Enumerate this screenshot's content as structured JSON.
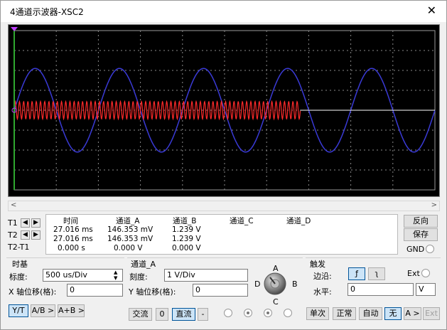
{
  "window": {
    "title": "4通道示波器-XSC2",
    "close_glyph": "✕"
  },
  "scope": {
    "background": "#000000",
    "grid_color": "#8a8a8a",
    "channel_a_color": "#ff2a2a",
    "channel_b_color": "#3a3ad6",
    "channel_a_label": "A",
    "channel_b_label": "B",
    "trace_a": {
      "waveform": "sine",
      "cycles_shown": 100,
      "amplitude_divisions": 0.2,
      "visible_until_fraction": 0.68
    },
    "trace_b": {
      "waveform": "sine",
      "cycles_shown": 5,
      "amplitude_divisions": 2.1
    }
  },
  "cursors": {
    "t1": "T1",
    "t2": "T2",
    "t2t1": "T2-T1"
  },
  "measure": {
    "headers": [
      "时间",
      "通道_A",
      "通道_B",
      "通道_C",
      "通道_D"
    ],
    "rows": [
      [
        "27.016 ms",
        "146.353 mV",
        "1.239 V",
        "",
        ""
      ],
      [
        "27.016 ms",
        "146.353 mV",
        "1.239 V",
        "",
        ""
      ],
      [
        "0.000 s",
        "0.000 V",
        "0.000 V",
        "",
        ""
      ]
    ]
  },
  "side_buttons": {
    "reverse": "反向",
    "save": "保存",
    "gnd": "GND"
  },
  "timebase": {
    "title": "时基",
    "scale_label": "标度:",
    "scale_value": "500 us/Div",
    "xpos_label": "X 轴位移(格):",
    "xpos_value": "0",
    "modes": [
      "Y/T",
      "A/B >",
      "A+B >"
    ]
  },
  "channel": {
    "title": "通道_A",
    "scale_label": "刻度:",
    "scale_value": "1  V/Div",
    "ypos_label": "Y 轴位移(格):",
    "ypos_value": "0",
    "coupling": [
      "交流",
      "0",
      "直流",
      "-"
    ],
    "knob_letters": [
      "A",
      "B",
      "C",
      "D"
    ]
  },
  "trigger": {
    "title": "触发",
    "edge_label": "边沿:",
    "rising_glyph": "ƒ",
    "falling_glyph": "ʅ",
    "ext_label": "Ext",
    "level_label": "水平:",
    "level_value": "0",
    "level_unit": "V",
    "modes": [
      "单次",
      "正常",
      "自动",
      "无",
      "A >",
      "Ext"
    ]
  }
}
